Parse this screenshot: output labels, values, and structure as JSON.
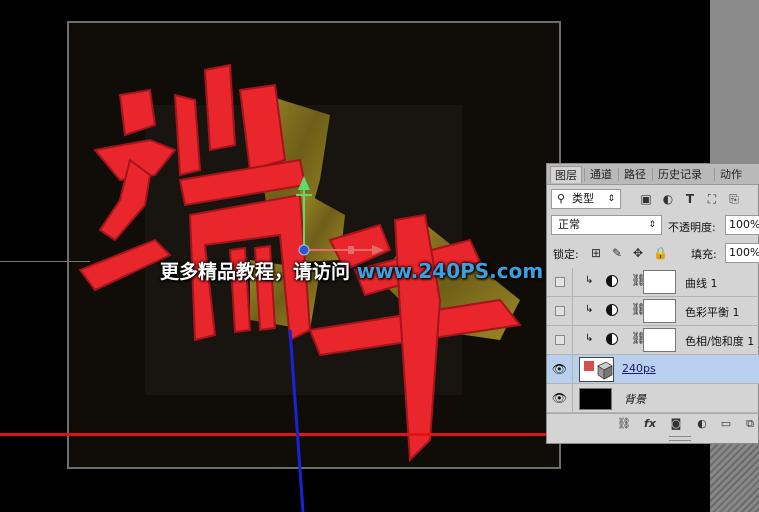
{
  "watermark": {
    "prefix": "更多精品教程，请访问 ",
    "url": "www.240PS.com"
  },
  "artwork": {
    "characters": [
      "端",
      "午"
    ],
    "fill_color": "#e8262c",
    "extrude_color": "#8a7a22"
  },
  "colors": {
    "ground_line": "#e01414",
    "y_axis": "#5fd96a",
    "z_axis": "#1a22d8",
    "x_axis": "#e86a6a",
    "selection": "#b9cfee"
  },
  "layers_panel": {
    "tabs": [
      "图层",
      "通道",
      "路径",
      "历史记录",
      "动作"
    ],
    "active_tab": "图层",
    "filter": {
      "label": "类型"
    },
    "blend_mode": "正常",
    "opacity_label": "不透明度:",
    "opacity_value": "100%",
    "lock_label": "锁定:",
    "fill_label": "填充:",
    "fill_value": "100%",
    "layers": [
      {
        "name": "曲线 1",
        "type": "adjustment",
        "visible": false,
        "clipped": true
      },
      {
        "name": "色彩平衡 1",
        "type": "adjustment",
        "visible": false,
        "clipped": true
      },
      {
        "name": "色相/饱和度 1",
        "type": "adjustment",
        "visible": false,
        "clipped": true
      },
      {
        "name": "240ps",
        "type": "3d",
        "visible": true,
        "selected": true
      },
      {
        "name": "背景",
        "type": "background",
        "visible": true
      }
    ]
  }
}
